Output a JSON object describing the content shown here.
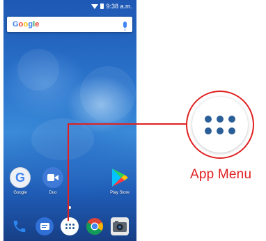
{
  "status_bar": {
    "time": "9:38 a.m."
  },
  "search": {
    "logo": "Google"
  },
  "home_apps": [
    {
      "name": "Google",
      "icon": "google-icon"
    },
    {
      "name": "Duo",
      "icon": "duo-icon"
    },
    {
      "name": "Play Store",
      "icon": "play-store-icon"
    }
  ],
  "dock": [
    {
      "icon": "phone-icon"
    },
    {
      "icon": "messages-icon"
    },
    {
      "icon": "app-drawer-icon"
    },
    {
      "icon": "chrome-icon"
    },
    {
      "icon": "camera-icon"
    }
  ],
  "callout": {
    "label": "App Menu"
  },
  "colors": {
    "accent": "#e02020",
    "drawer_dots": "#2c5f97"
  }
}
